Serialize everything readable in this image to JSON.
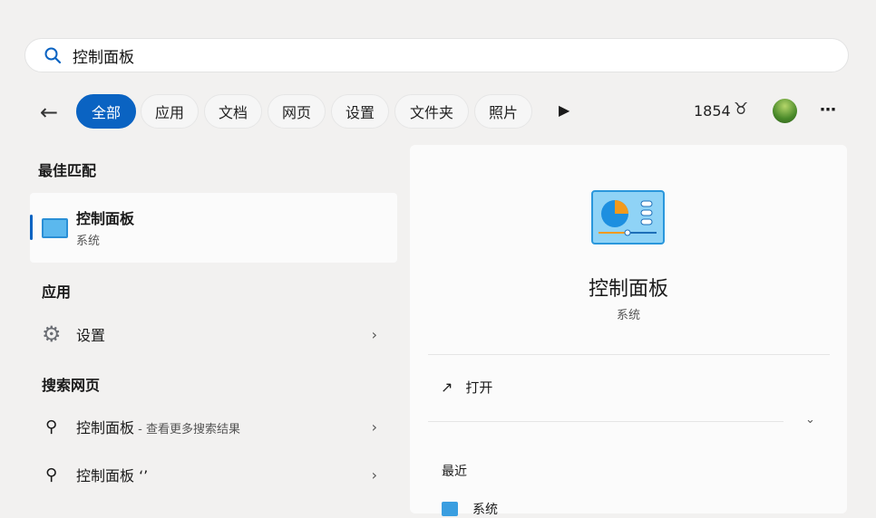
{
  "search": {
    "value": "控制面板"
  },
  "filters": [
    "全部",
    "应用",
    "文档",
    "网页",
    "设置",
    "文件夹",
    "照片"
  ],
  "points": "1854",
  "best_match": {
    "heading": "最佳匹配",
    "title": "控制面板",
    "subtitle": "系统"
  },
  "apps": {
    "heading": "应用",
    "items": [
      {
        "label": "设置"
      }
    ]
  },
  "web": {
    "heading": "搜索网页",
    "items": [
      {
        "label": "控制面板",
        "hint": " - 查看更多搜索结果"
      },
      {
        "label": "控制面板 ‘’",
        "hint": ""
      }
    ]
  },
  "detail": {
    "title": "控制面板",
    "subtitle": "系统",
    "open": "打开",
    "recent_heading": "最近",
    "recent": [
      {
        "label": "系统"
      }
    ]
  },
  "colors": {
    "accent": "#0a63c2"
  }
}
